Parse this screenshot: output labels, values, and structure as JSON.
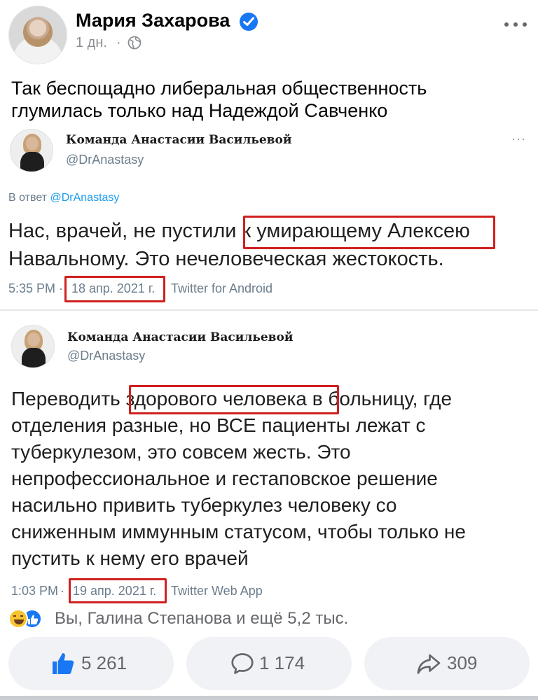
{
  "post": {
    "author": "Мария Захарова",
    "time": "1 дн.",
    "separator": "·",
    "text_lines": [
      "Так беспощадно либеральная общественность",
      "глумилась только  над Надеждой Савченко"
    ]
  },
  "tweets": [
    {
      "name": "Команда Анастасии Васильевой",
      "handle": "@DrAnastasy",
      "more": "···",
      "reply_prefix": "В ответ",
      "reply_mention": "@DrAnastasy",
      "body_lines": [
        "Нас, врачей, не пустили к умирающему Алексею",
        "Навальному. Это нечеловеческая жестокость."
      ],
      "highlighted_phrase": "к умирающему Алексею",
      "meta_time": "5:35 PM",
      "meta_dot": "·",
      "meta_date": "18 апр. 2021 г.",
      "meta_source": "Twitter for Android"
    },
    {
      "name": "Команда Анастасии Васильевой",
      "handle": "@DrAnastasy",
      "body_lines": [
        "Переводить здорового человека в больницу, где",
        "отделения разные, но ВСЕ пациенты лежат с",
        "туберкулезом, это совсем жесть. Это",
        "непрофессиональное и гестаповское решение",
        "насильно привить туберкулез человеку со",
        "сниженным иммунным статусом, чтобы только не",
        "пустить к нему его врачей"
      ],
      "highlighted_phrase": "здорового человека",
      "meta_time": "1:03 PM",
      "meta_dot": "·",
      "meta_date": "19 апр. 2021 г.",
      "meta_source": "Twitter Web App"
    }
  ],
  "reactions": {
    "icons": [
      "haha-icon",
      "like-icon"
    ],
    "summary": "Вы, Галина Степанова и ещё 5,2 тыс."
  },
  "actions": {
    "likes": "5 261",
    "comments": "1 174",
    "shares": "309"
  },
  "colors": {
    "brand_blue": "#1877f2",
    "highlight_red": "#d0201f",
    "twitter_blue": "#1d9bf0",
    "muted": "#65676b"
  }
}
